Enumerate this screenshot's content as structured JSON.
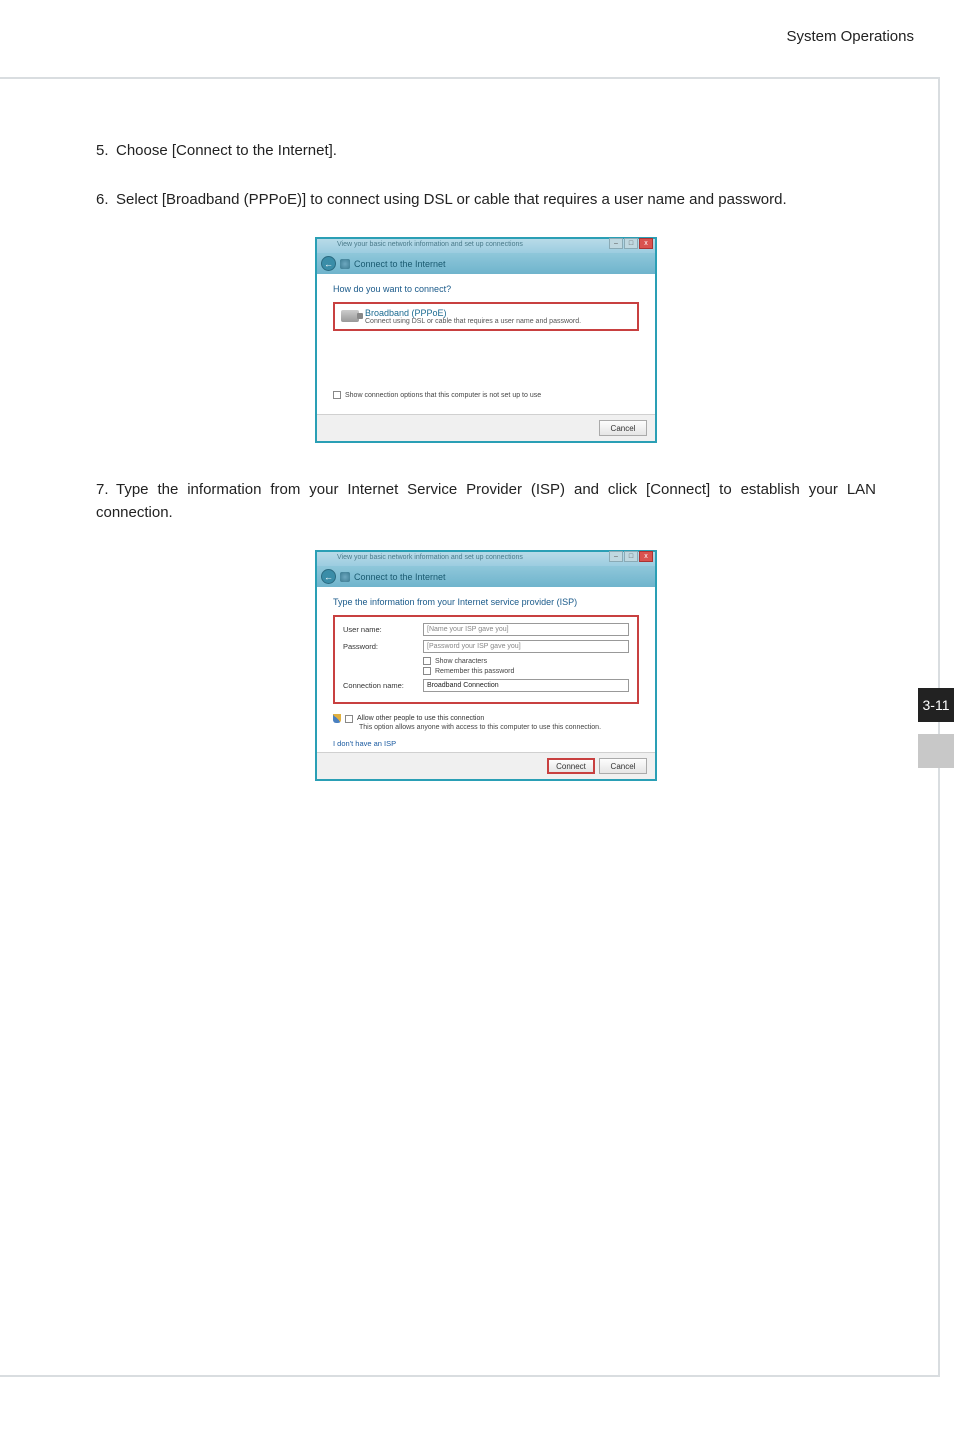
{
  "header": {
    "section": "System Operations"
  },
  "page_num": "3-11",
  "steps": {
    "s5": {
      "n": "5.",
      "text": "Choose [Connect to the Internet]."
    },
    "s6": {
      "n": "6.",
      "text": "Select [Broadband (PPPoE)] to connect using DSL or cable that requires a user name and password."
    },
    "s7": {
      "n": "7.",
      "text": "Type the information from your Internet Service Provider (ISP) and click [Connect] to establish your LAN connection."
    }
  },
  "dlg1": {
    "titlebar_hint": "View your basic network information and set up connections",
    "nav_title": "Connect to the Internet",
    "instruction": "How do you want to connect?",
    "opt_title": "Broadband (PPPoE)",
    "opt_desc": "Connect using DSL or cable that requires a user name and password.",
    "show_opts": "Show connection options that this computer is not set up to use",
    "cancel": "Cancel",
    "win": {
      "min": "–",
      "max": "□",
      "close": "x"
    }
  },
  "dlg2": {
    "titlebar_hint": "View your basic network information and set up connections",
    "nav_title": "Connect to the Internet",
    "instruction": "Type the information from your Internet service provider (ISP)",
    "username_label": "User name:",
    "username_ph": "[Name your ISP gave you]",
    "password_label": "Password:",
    "password_ph": "[Password your ISP gave you]",
    "show_chars": "Show characters",
    "remember": "Remember this password",
    "connname_label": "Connection name:",
    "connname_val": "Broadband Connection",
    "allow_label": "Allow other people to use this connection",
    "allow_desc": "This option allows anyone with access to this computer to use this connection.",
    "no_isp": "I don't have an ISP",
    "connect": "Connect",
    "cancel": "Cancel",
    "win": {
      "min": "–",
      "max": "□",
      "close": "x"
    }
  }
}
